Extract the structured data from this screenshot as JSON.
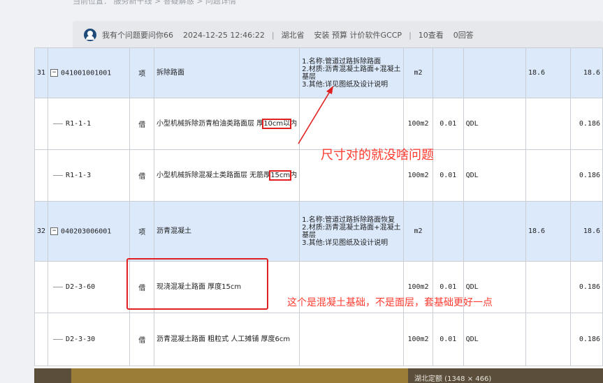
{
  "breadcrumb": "当前位置：  服务新干线 > 答疑解惑 > 问题详情",
  "question": {
    "asker": "我有个问题要问你66",
    "datetime": "2024-12-25 12:46:22",
    "separator": "|",
    "region": "湖北省",
    "tags": "安装 预算 计价软件GCCP",
    "views": "10查看",
    "answers": "0回答"
  },
  "image_caption": "湖北定额 (1348 × 466)",
  "rows": [
    {
      "type": "parent",
      "index": "31",
      "code": "041001001001",
      "kind": "项",
      "name": "拆除路面",
      "feature": "1.名称:管道过路拆除路面\n2.材质:沥青混凝土路面+混凝土基层\n3.其他:详见图纸及设计说明",
      "unit": "m2",
      "factor": "",
      "std": "",
      "qty1": "18.6",
      "qty2": "18.6"
    },
    {
      "type": "child",
      "index": "",
      "code": "R1-1-1",
      "kind": "借",
      "name_pre": "小型机械拆除沥青柏油类路面层 厚",
      "name_hl": "10cm以",
      "name_post": "内",
      "feature": "",
      "unit": "100m2",
      "factor": "0.01",
      "std": "QDL",
      "qty1": "",
      "qty2": "0.186"
    },
    {
      "type": "child",
      "index": "",
      "code": "R1-1-3",
      "kind": "借",
      "name_pre": "小型机械拆除混凝土类路面层 无筋厚",
      "name_hl": "15cm",
      "name_post": "内",
      "feature": "",
      "unit": "100m2",
      "factor": "0.01",
      "std": "QDL",
      "qty1": "",
      "qty2": "0.186"
    },
    {
      "type": "parent",
      "index": "32",
      "code": "040203006001",
      "kind": "项",
      "name": "沥青混凝土",
      "feature": "1.名称:管道过路拆除路面恢复\n2.材质:沥青混凝土路面+混凝土基层\n3.其他:详见图纸及设计说明",
      "unit": "m2",
      "factor": "",
      "std": "",
      "qty1": "18.6",
      "qty2": "18.6"
    },
    {
      "type": "child",
      "index": "",
      "code": "D2-3-60",
      "kind": "借",
      "name": "现浇混凝土路面 厚度15cm",
      "feature": "",
      "unit": "100m2",
      "factor": "0.01",
      "std": "QDL",
      "qty1": "",
      "qty2": "0.186"
    },
    {
      "type": "child",
      "index": "",
      "code": "D2-3-30",
      "kind": "借",
      "name": "沥青混凝土路面 粗粒式 人工摊铺 厚度6cm",
      "feature": "",
      "unit": "100m2",
      "factor": "0.01",
      "std": "QDL",
      "qty1": "",
      "qty2": "0.186"
    }
  ],
  "annotations": {
    "note1": "尺寸对的就没啥问题",
    "note2": "这个是混凝土基础，不是面层，套基础更好一点",
    "color": "#e02020"
  }
}
